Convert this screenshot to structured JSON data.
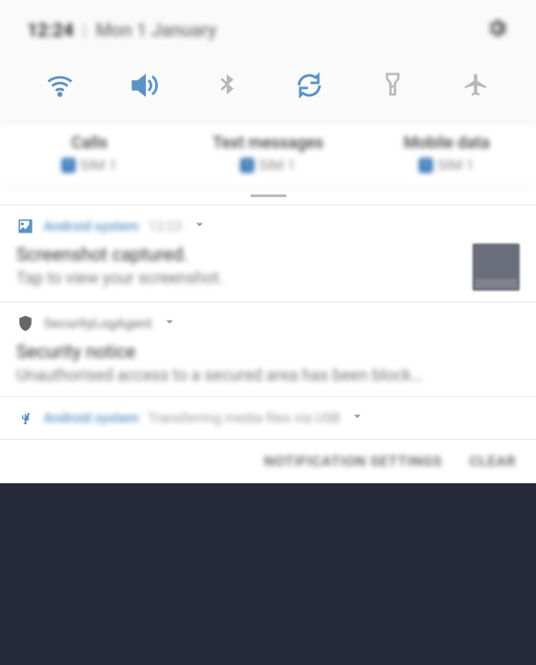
{
  "header": {
    "time": "12:24",
    "date": "Mon 1 January"
  },
  "sim": {
    "cols": [
      {
        "title": "Calls",
        "badge": "1",
        "val": "SIM 1"
      },
      {
        "title": "Text messages",
        "badge": "1",
        "val": "SIM 1"
      },
      {
        "title": "Mobile data",
        "badge": "1",
        "val": "SIM 1"
      }
    ]
  },
  "n1": {
    "app": "Android system",
    "time": "12:23",
    "title": "Screenshot captured.",
    "desc": "Tap to view your screenshot."
  },
  "n2": {
    "app": "SecurityLogAgent",
    "title": "Security notice",
    "desc": "Unauthorised access to a secured area has been block…"
  },
  "n3": {
    "app": "Android system",
    "sub": "Transferring media files via USB"
  },
  "footer": {
    "settings": "NOTIFICATION SETTINGS",
    "clear": "CLEAR"
  }
}
